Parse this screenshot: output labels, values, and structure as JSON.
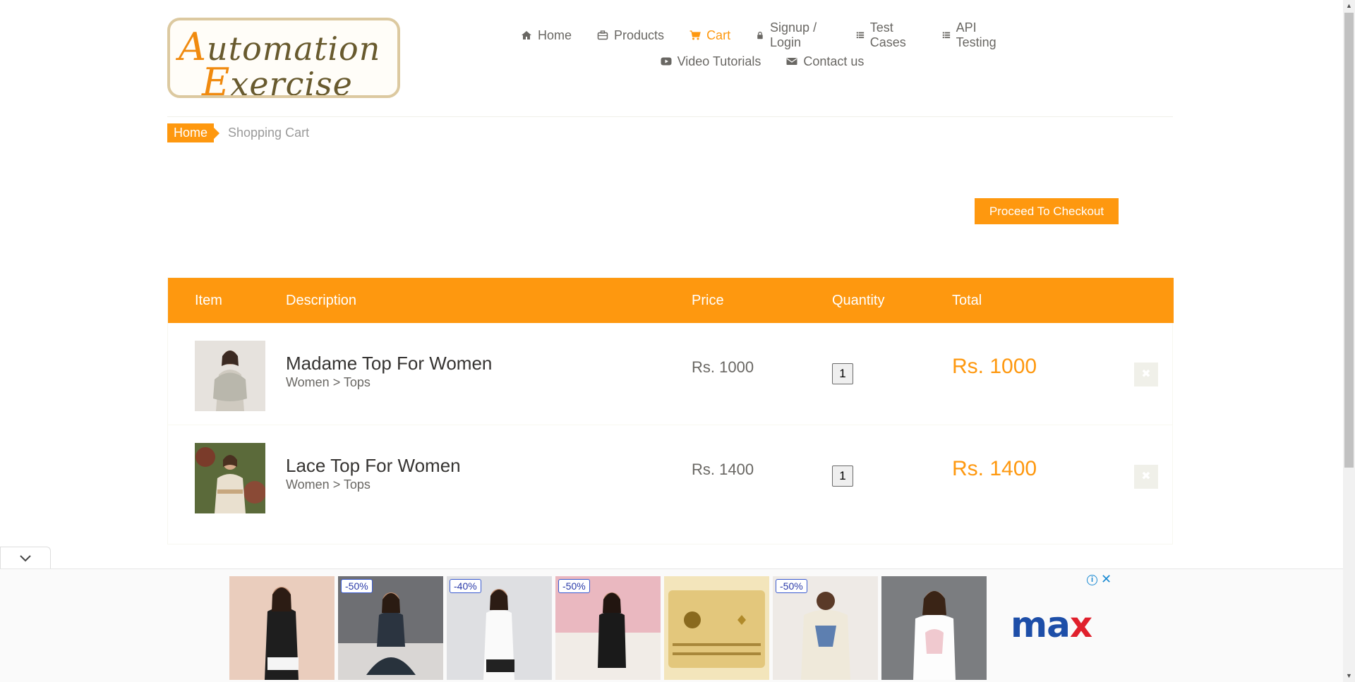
{
  "logo": {
    "line1_cap": "A",
    "line1_rest": "utomation",
    "line2_cap": "E",
    "line2_rest": "xercise"
  },
  "nav": {
    "row1": [
      {
        "label": "Home",
        "icon": "home-icon",
        "active": false
      },
      {
        "label": "Products",
        "icon": "briefcase-icon",
        "active": false
      },
      {
        "label": "Cart",
        "icon": "cart-icon",
        "active": true
      },
      {
        "label": "Signup / Login",
        "icon": "lock-icon",
        "active": false
      },
      {
        "label": "Test Cases",
        "icon": "list-icon",
        "active": false
      },
      {
        "label": "API Testing",
        "icon": "list-icon",
        "active": false
      }
    ],
    "row2": [
      {
        "label": "Video Tutorials",
        "icon": "youtube-icon",
        "active": false
      },
      {
        "label": "Contact us",
        "icon": "envelope-icon",
        "active": false
      }
    ]
  },
  "breadcrumb": {
    "home": "Home",
    "current": "Shopping Cart"
  },
  "checkout_label": "Proceed To Checkout",
  "table": {
    "headers": {
      "item": "Item",
      "description": "Description",
      "price": "Price",
      "quantity": "Quantity",
      "total": "Total"
    },
    "rows": [
      {
        "name": "Madame Top For Women",
        "category": "Women > Tops",
        "price": "Rs. 1000",
        "quantity": "1",
        "total": "Rs. 1000"
      },
      {
        "name": "Lace Top For Women",
        "category": "Women > Tops",
        "price": "Rs. 1400",
        "quantity": "1",
        "total": "Rs. 1400"
      }
    ]
  },
  "ads": {
    "discounts": [
      "-50%",
      "-40%",
      "-50%",
      "-50%"
    ],
    "brand": "max",
    "info_icon": "info-icon",
    "close_icon": "close-icon"
  },
  "colors": {
    "accent": "#fe980f",
    "text": "#696763",
    "ad_link": "#1a8ad2",
    "max_blue": "#1d4ea8",
    "max_red": "#e0202c"
  }
}
